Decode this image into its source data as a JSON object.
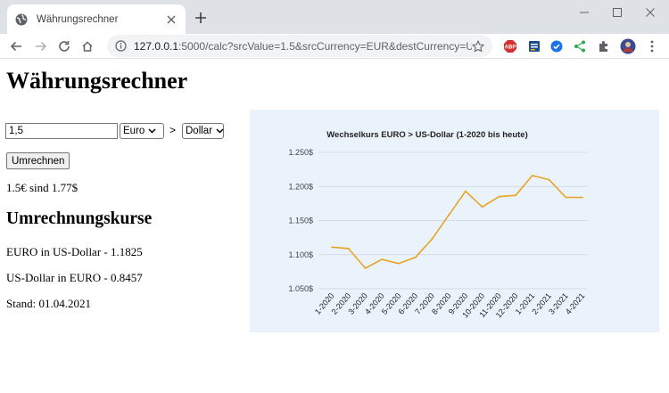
{
  "browser": {
    "tab_title": "Währungsrechner",
    "url_host": "127.0.0.1",
    "url_rest": ":5000/calc?srcValue=1.5&srcCurrency=EUR&destCurrency=U..."
  },
  "page": {
    "title": "Währungsrechner",
    "form": {
      "amount_value": "1,5",
      "source_currency": "Euro",
      "separator": ">",
      "target_currency": "Dollar",
      "convert_label": "Umrechnen"
    },
    "result": "1.5€ sind 1.77$",
    "rates": {
      "heading": "Umrechnungskurse",
      "euro_usd": "EURO in US-Dollar - 1.1825",
      "usd_euro": "US-Dollar in EURO - 0.8457",
      "date": "Stand: 01.04.2021"
    }
  },
  "colors": {
    "line": "#e8a323",
    "chart_bg": "#eaf3fc"
  },
  "chart_data": {
    "type": "line",
    "title": "Wechselkurs EURO > US-Dollar (1-2020 bis heute)",
    "xlabel": "",
    "ylabel": "",
    "categories": [
      "1-2020",
      "2-2020",
      "3-2020",
      "4-2020",
      "5-2020",
      "6-2020",
      "7-2020",
      "8-2020",
      "9-2020",
      "10-2020",
      "11-2020",
      "12-2020",
      "1-2021",
      "2-2021",
      "3-2021",
      "4-2021"
    ],
    "series": [
      {
        "values": [
          1.111,
          1.109,
          1.08,
          1.093,
          1.087,
          1.096,
          1.123,
          1.158,
          1.193,
          1.17,
          1.185,
          1.187,
          1.216,
          1.21,
          1.184,
          1.184
        ]
      }
    ],
    "ytick_labels": [
      "1.050$",
      "1.100$",
      "1.150$",
      "1.200$",
      "1.250$"
    ],
    "yticks": [
      1.05,
      1.1,
      1.15,
      1.2,
      1.25
    ],
    "ylim": [
      1.05,
      1.25
    ],
    "grid": true,
    "legend": "none"
  }
}
